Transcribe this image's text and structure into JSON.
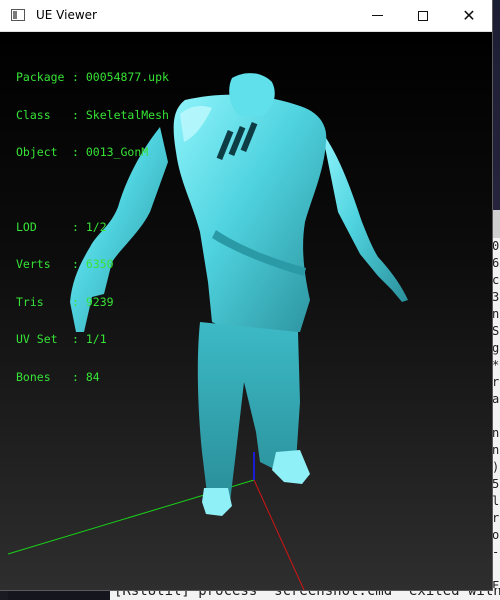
{
  "window": {
    "title": "UE Viewer",
    "icon": "app-window-icon",
    "controls": {
      "minimize": "minimize-icon",
      "maximize": "maximize-icon",
      "close_glyph": "✕"
    }
  },
  "info": {
    "package": {
      "label": "Package",
      "value": "00054877.upk"
    },
    "class": {
      "label": "Class",
      "value": "SkeletalMesh"
    },
    "object": {
      "label": "Object",
      "value": "0013_GonM"
    },
    "lod": {
      "label": "LOD",
      "value": "1/2"
    },
    "verts": {
      "label": "Verts",
      "value": "6350"
    },
    "tris": {
      "label": "Tris",
      "value": "9239"
    },
    "uvset": {
      "label": "UV Set",
      "value": "1/1"
    },
    "bones": {
      "label": "Bones",
      "value": "84"
    },
    "separator": ":"
  },
  "console_right": {
    "chars": [
      "0",
      "6",
      "c",
      "3",
      "n",
      "S",
      "g",
      "*",
      "r",
      "a",
      "",
      "n",
      "n",
      ")",
      "5",
      "l",
      "r",
      "o",
      "-",
      "",
      "F",
      "i"
    ]
  },
  "console_bottom": {
    "text": "[RstUtil] process \"screenshot.cmd\" exited with c"
  },
  "left_strip": {
    "mark": "M"
  },
  "colors": {
    "mesh": "#4fd3df",
    "info_text": "#36e336",
    "axis_x": "#d01515",
    "axis_y": "#19d019",
    "axis_z": "#1b1bd6"
  }
}
